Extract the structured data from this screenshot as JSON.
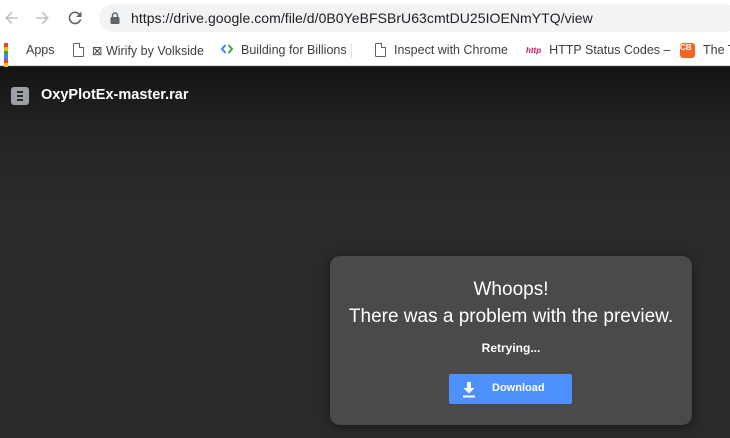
{
  "browser": {
    "url": "https://drive.google.com/file/d/0B0YeBFSBrU63cmtDU25IOENmYTQ/view",
    "icons": {
      "back": "arrow-back-icon",
      "forward": "arrow-forward-icon",
      "reload": "reload-icon",
      "lock": "lock-icon"
    }
  },
  "bookmarks": [
    {
      "label": "Apps",
      "icon": "apps-grid-icon"
    },
    {
      "label": "⊠ Wirify by Volkside",
      "icon": "page-icon"
    },
    {
      "label": "Building for Billions",
      "icon": "google-dev-icon"
    },
    {
      "label": "Inspect with Chrome",
      "icon": "page-icon"
    },
    {
      "label": "HTTP Status Codes –",
      "icon": "http-icon",
      "icon_text": "http"
    },
    {
      "label": "The T",
      "icon": "cb-icon",
      "icon_text": "CB"
    }
  ],
  "viewer": {
    "file_name": "OxyPlotEx-master.rar",
    "file_icon": "archive-file-icon"
  },
  "error_card": {
    "title": "Whoops!",
    "message": "There was a problem with the preview.",
    "status": "Retrying...",
    "download_label": "Download",
    "download_icon": "download-icon",
    "button_color": "#4d90fe"
  }
}
